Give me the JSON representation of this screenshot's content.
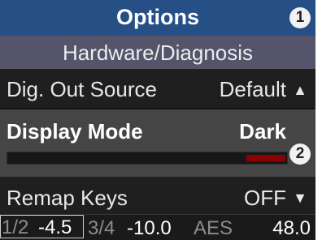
{
  "header": {
    "title": "Options",
    "callout_1": "1",
    "subtitle": "Hardware/Diagnosis"
  },
  "menu": {
    "dig_out": {
      "label": "Dig. Out Source",
      "value": "Default",
      "arrow": "▲"
    },
    "display_mode": {
      "label": "Display Mode",
      "value": "Dark",
      "callout": "2",
      "level_fraction": 0.14
    },
    "remap_keys": {
      "label": "Remap Keys",
      "value": "OFF",
      "arrow": "▼"
    }
  },
  "status": {
    "ch12_label": "1/2",
    "ch12_value": "-4.5",
    "ch34_label": "3/4",
    "ch34_value": "-10.0",
    "aes_label": "AES",
    "aes_value": "48.0"
  },
  "colors": {
    "title_bar": "#264f85",
    "sub_bar": "#54546a",
    "selected_row": "#454545",
    "level_fill": "#8b0000",
    "background": "#1f1f1f"
  }
}
